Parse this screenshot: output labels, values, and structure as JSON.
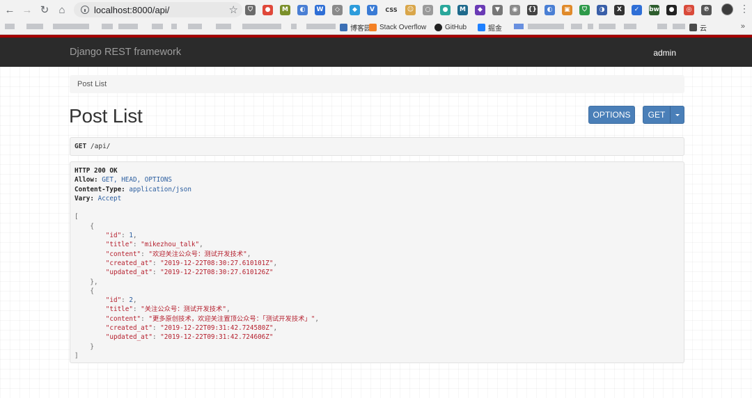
{
  "browser": {
    "url": "localhost:8000/api/",
    "extensions": [
      {
        "icon": "shield-ext-icon",
        "color": "#6b6b6b",
        "glyph": "⛉"
      },
      {
        "icon": "pinwheel-ext-icon",
        "color": "#e0483a",
        "glyph": "●"
      },
      {
        "icon": "m-ext-icon",
        "color": "#7a8f2a",
        "glyph": "M"
      },
      {
        "icon": "sync-ext-icon",
        "color": "#4a7fd4",
        "glyph": "◐"
      },
      {
        "icon": "w-ext-icon",
        "color": "#2f6fd6",
        "glyph": "W"
      },
      {
        "icon": "cat-ext-icon",
        "color": "#8a8a8a",
        "glyph": "◇"
      },
      {
        "icon": "bird-ext-icon",
        "color": "#2d9cdb",
        "glyph": "◆"
      },
      {
        "icon": "vue-ext-icon",
        "color": "#3a7bd5",
        "glyph": "V"
      },
      {
        "icon": "css-ext-icon",
        "color": "#333333",
        "glyph": "CSS"
      },
      {
        "icon": "face-ext-icon",
        "color": "#d9a64a",
        "glyph": "☺"
      },
      {
        "icon": "circle-ext-icon",
        "color": "#9a9a9a",
        "glyph": "○"
      },
      {
        "icon": "teal-ext-icon",
        "color": "#2aa79b",
        "glyph": "●"
      },
      {
        "icon": "m2-ext-icon",
        "color": "#1f6a8c",
        "glyph": "M"
      },
      {
        "icon": "cube-ext-icon",
        "color": "#6a3bb5",
        "glyph": "◆"
      },
      {
        "icon": "v-ext-icon",
        "color": "#777777",
        "glyph": "▼"
      },
      {
        "icon": "globe-ext-icon",
        "color": "#8a8a8a",
        "glyph": "◉"
      },
      {
        "icon": "braces-ext-icon",
        "color": "#444444",
        "glyph": "{}"
      },
      {
        "icon": "sync2-ext-icon",
        "color": "#4a7fd4",
        "glyph": "◐"
      },
      {
        "icon": "orange-ext-icon",
        "color": "#e08a2a",
        "glyph": "▣"
      },
      {
        "icon": "green-shield-ext-icon",
        "color": "#2e9a4a",
        "glyph": "⛉"
      },
      {
        "icon": "moon-ext-icon",
        "color": "#3a5fa8",
        "glyph": "◑"
      },
      {
        "icon": "x-ext-icon",
        "color": "#333333",
        "glyph": "X"
      },
      {
        "icon": "check-ext-icon",
        "color": "#2f6fd6",
        "glyph": "✓"
      },
      {
        "icon": "bw-ext-icon",
        "color": "#2e5d2e",
        "glyph": "bw"
      },
      {
        "icon": "dark-circle-ext-icon",
        "color": "#222222",
        "glyph": "●"
      },
      {
        "icon": "chrome-ext-icon",
        "color": "#d94a3a",
        "glyph": "◎"
      },
      {
        "icon": "p-ext-icon",
        "color": "#555555",
        "glyph": "℗"
      }
    ],
    "bookmarks": [
      {
        "label": "博客园",
        "icon": "cnblogs-icon",
        "color": "#3b6fb5"
      },
      {
        "label": "Stack Overflow",
        "icon": "stackoverflow-icon",
        "color": "#f48024"
      },
      {
        "label": "GitHub",
        "icon": "github-icon",
        "color": "#222222"
      },
      {
        "label": "掘金",
        "icon": "juejin-icon",
        "color": "#1e80ff"
      },
      {
        "label": "云",
        "icon": "cloud-icon",
        "color": "#4a4a4a"
      }
    ],
    "more_label": "»"
  },
  "navbar": {
    "brand": "Django REST framework",
    "user": "admin",
    "accent": "#a30000",
    "background": "#2b2b2b"
  },
  "breadcrumb": {
    "current": "Post List"
  },
  "page": {
    "title": "Post List",
    "options_label": "OPTIONS",
    "get_label": "GET"
  },
  "request": {
    "method": "GET",
    "path": "/api/"
  },
  "response": {
    "status_line": "HTTP 200 OK",
    "headers": [
      {
        "key": "Allow:",
        "value": "GET, HEAD, OPTIONS"
      },
      {
        "key": "Content-Type:",
        "value": "application/json"
      },
      {
        "key": "Vary:",
        "value": "Accept"
      }
    ],
    "posts": [
      {
        "id": "1",
        "title": "\"mikezhou_talk\"",
        "content": "\"欢迎关注公众号：测试开发技术\"",
        "created_at": "\"2019-12-22T08:30:27.610101Z\"",
        "updated_at": "\"2019-12-22T08:30:27.610126Z\""
      },
      {
        "id": "2",
        "title": "\"关注公众号：测试开发技术\"",
        "content": "\"更多原创技术，欢迎关注置顶公众号：「测试开发技术」\"",
        "created_at": "\"2019-12-22T09:31:42.724580Z\"",
        "updated_at": "\"2019-12-22T09:31:42.724606Z\""
      }
    ]
  }
}
